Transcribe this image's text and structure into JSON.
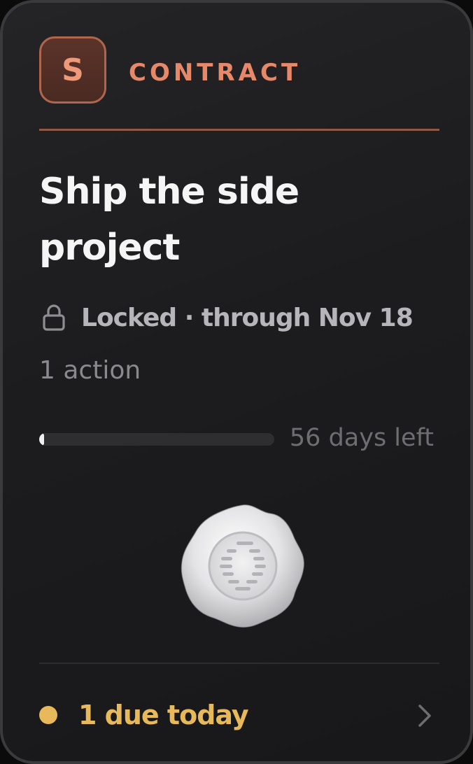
{
  "card": {
    "badge_letter": "S",
    "badge_label": "CONTRACT",
    "title": "Ship the side project",
    "lock_icon": "lock-icon",
    "status_text": "Locked · through Nov 18",
    "actions_text": "1 action",
    "progress": {
      "fraction": 0.01,
      "days_left_text": "56 days left"
    },
    "seal_icon": "wax-seal-icon",
    "footer": {
      "due_text": "1 due today",
      "dot_color": "#e7b95a",
      "chevron_icon": "chevron-right-icon"
    },
    "colors": {
      "accent": "#e5896a",
      "due": "#e7b95a",
      "background": "#1c1c1e"
    }
  }
}
